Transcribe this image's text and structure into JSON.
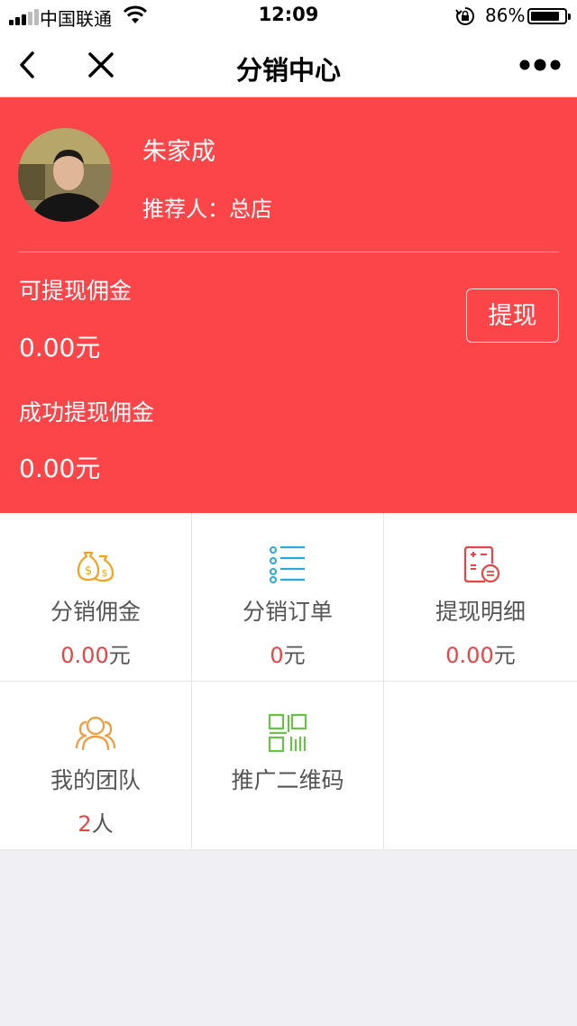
{
  "status_bar": {
    "carrier": "中国联通",
    "time": "12:09",
    "battery_percent": "86%",
    "battery_level": 0.86
  },
  "nav": {
    "title": "分销中心",
    "back_icon": "chevron-left-icon",
    "close_icon": "close-icon",
    "more_icon": "more-dots-icon"
  },
  "profile": {
    "name": "朱家成",
    "referrer": "推荐人：总店",
    "available_label": "可提现佣金",
    "available_value": "0.00元",
    "withdrawn_label": "成功提现佣金",
    "withdrawn_value": "0.00元",
    "withdraw_button": "提现",
    "accent_color": "#fc4548"
  },
  "grid": [
    {
      "label": "分销佣金",
      "value_num": "0.00",
      "value_unit": "元",
      "icon": "money-bag-icon"
    },
    {
      "label": "分销订单",
      "value_num": "0",
      "value_unit": "元",
      "icon": "list-icon"
    },
    {
      "label": "提现明细",
      "value_num": "0.00",
      "value_unit": "元",
      "icon": "calculator-icon"
    },
    {
      "label": "我的团队",
      "value_num": "2",
      "value_unit": "人",
      "icon": "team-icon"
    },
    {
      "label": "推广二维码",
      "value_num": "",
      "value_unit": "",
      "icon": "qr-code-icon"
    }
  ]
}
